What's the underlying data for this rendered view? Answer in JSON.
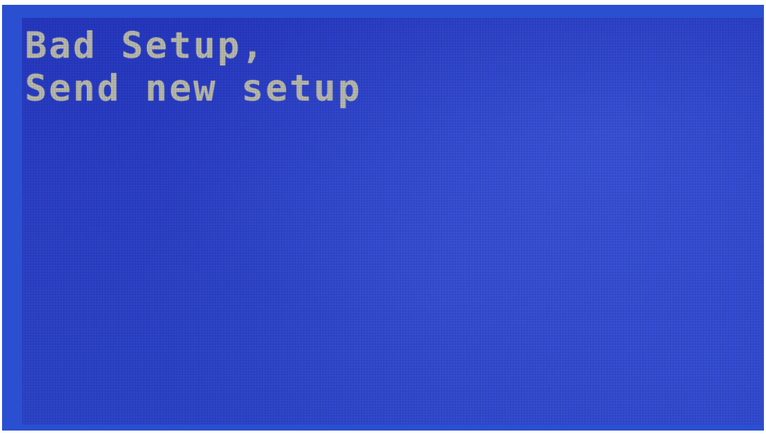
{
  "screen": {
    "lines": [
      "Bad Setup,",
      "Send new setup"
    ]
  },
  "colors": {
    "bezel": "#2a4fd0",
    "screen_background": "#2b40c6",
    "text": "#b7b8a9"
  }
}
